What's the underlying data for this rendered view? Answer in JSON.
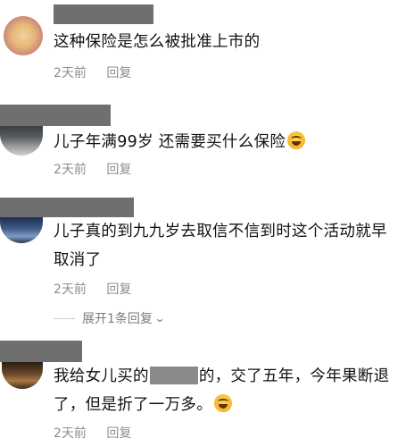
{
  "comments": [
    {
      "text": "这种保险是怎么被批准上市的",
      "time": "2天前",
      "reply": "回复"
    },
    {
      "text": "儿子年满99岁 还需要买什么保险",
      "time": "2天前",
      "reply": "回复",
      "emoji": "laughing-crying-emoji"
    },
    {
      "text": "儿子真的到九九岁去取信不信到时这个活动就早取消了",
      "time": "2天前",
      "reply": "回复",
      "expand_label": "展开1条回复"
    },
    {
      "text_before": "我给女儿买的",
      "text_after": "的，交了五年，今年果断退了，但是折了一万多。",
      "time": "2天前",
      "reply": "回复",
      "emoji": "laughing-crying-emoji"
    }
  ],
  "colors": {
    "text": "#111111",
    "meta": "#8d8d8d",
    "redaction": "#6f6f6f"
  }
}
